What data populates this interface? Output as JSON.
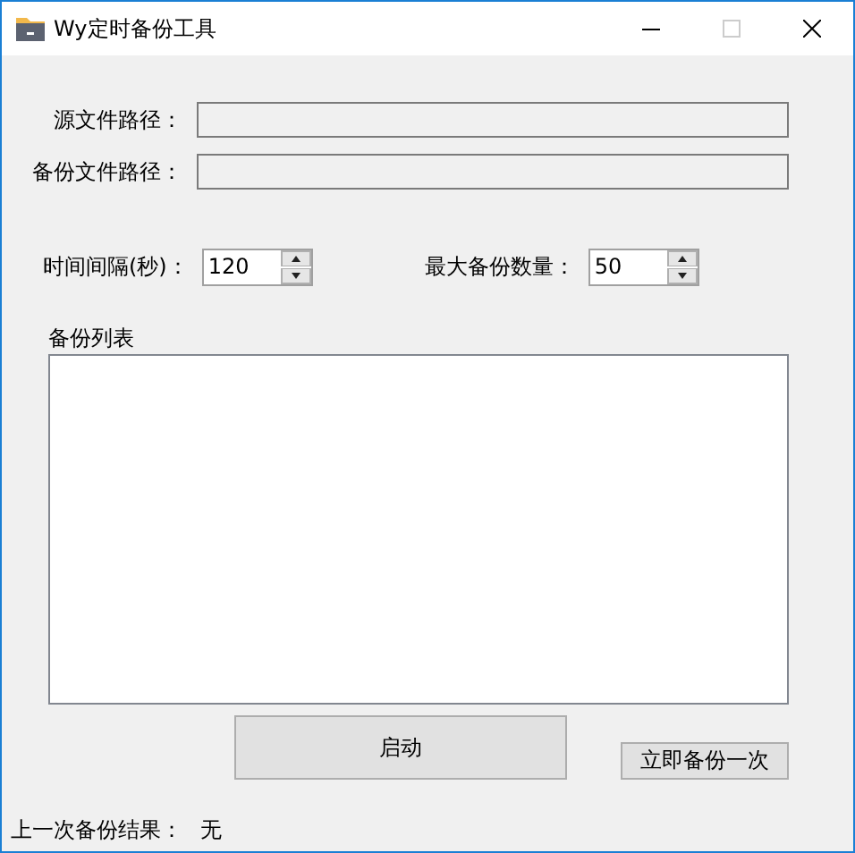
{
  "window": {
    "title": "Wy定时备份工具",
    "maximize_disabled": true
  },
  "path_fields": [
    {
      "label": "源文件路径：",
      "disabled": true
    },
    {
      "label": "备份文件路径：",
      "disabled": true
    }
  ],
  "spinners": [
    {
      "label": "时间间隔(秒)：",
      "value": "120"
    },
    {
      "label": "最大备份数量：",
      "value": "50"
    }
  ],
  "backup_list": {
    "label": "备份列表"
  },
  "buttons": [
    {
      "label": "启动",
      "kind": "large"
    },
    {
      "label": "立即备份一次",
      "kind": "small"
    }
  ],
  "status": {
    "label": "上一次备份结果：",
    "value": "无"
  }
}
